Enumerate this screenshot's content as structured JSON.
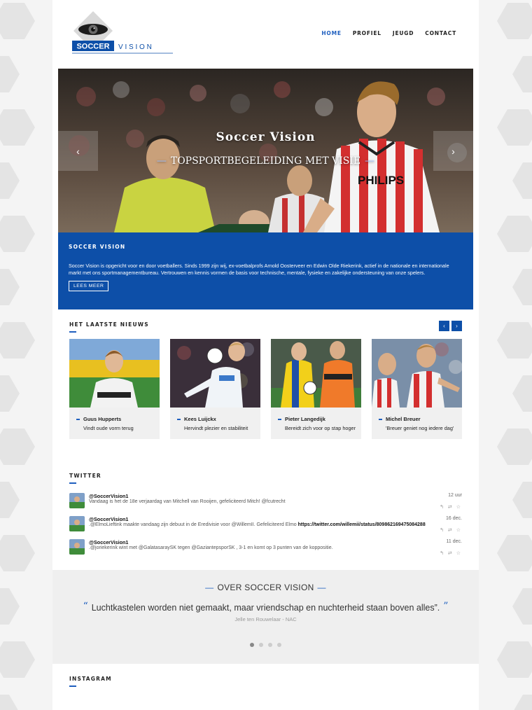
{
  "brand": {
    "name_box": "SOCCER",
    "name_spaced": "V I S I O N",
    "accent": "#1f5fbf",
    "blue": "#0d4fa8"
  },
  "nav": [
    {
      "label": "HOME",
      "active": true
    },
    {
      "label": "PROFIEL",
      "active": false
    },
    {
      "label": "JEUGD",
      "active": false
    },
    {
      "label": "CONTACT",
      "active": false
    }
  ],
  "hero": {
    "title": "Soccer Vision",
    "subtitle": "TOPSPORTBEGELEIDING MET VISIE",
    "shirt_sponsor": "PHILIPS",
    "prev_icon": "‹",
    "next_icon": "›"
  },
  "intro": {
    "title": "SOCCER VISION",
    "text": "Soccer Vision is opgericht voor en door voetballers. Sinds 1999 zijn wij, ex-voetbalprofs Arnold Oosterveer en Edwin Olde Riekerink, actief in de nationale en internationale markt met ons sportmanagementbureau. Vertrouwen en kennis vormen de basis voor technische, mentale, fysieke en zakelijke ondersteuning van onze spelers.",
    "button": "LEES MEER"
  },
  "news": {
    "title": "HET LAATSTE NIEUWS",
    "prev_icon": "‹",
    "next_icon": "›",
    "items": [
      {
        "name": "Guus Hupperts",
        "desc": "Vindt oude vorm terug"
      },
      {
        "name": "Kees Luijckx",
        "desc": "Hervindt plezier en stabiliteit"
      },
      {
        "name": "Pieter Langedijk",
        "desc": "Bereidt zich voor op stap hoger"
      },
      {
        "name": "Michel Breuer",
        "desc": "'Breuer geniet nog iedere dag'"
      }
    ]
  },
  "twitter": {
    "title": "TWITTER",
    "actions": "↰ ⇄ ☆",
    "tweets": [
      {
        "user": "@SoccerVision1",
        "text": "Vandaag is het de 18e verjaardag van Mitchell van Rooijen, gefeliciteerd Mitch! @fcutrecht",
        "link": "",
        "time": "12 uur"
      },
      {
        "user": "@SoccerVision1",
        "text": ".@ElmoLieftink maakte vandaag zijn debuut in de Eredivisie voor @WillemII. Gefeliciteerd Elmo ",
        "link": "https://twitter.com/willemii/status/809862169475084288",
        "time": "16 dec."
      },
      {
        "user": "@SoccerVision1",
        "text": ".@joriekerink wint met @GalatasaraySK tegen @GaziantepsporSK , 3-1 en komt op 3 punten van de koppositie.",
        "link": "",
        "time": "11 dec."
      }
    ]
  },
  "quote": {
    "title": "OVER SOCCER VISION",
    "open": "“",
    "close": "”",
    "text": "Luchtkastelen worden niet gemaakt, maar vriendschap en nuchterheid staan boven alles”.",
    "author": "Jelle ten Rouwelaar - NAC",
    "slides": 4,
    "active_slide": 1
  },
  "instagram": {
    "title": "INSTAGRAM"
  }
}
